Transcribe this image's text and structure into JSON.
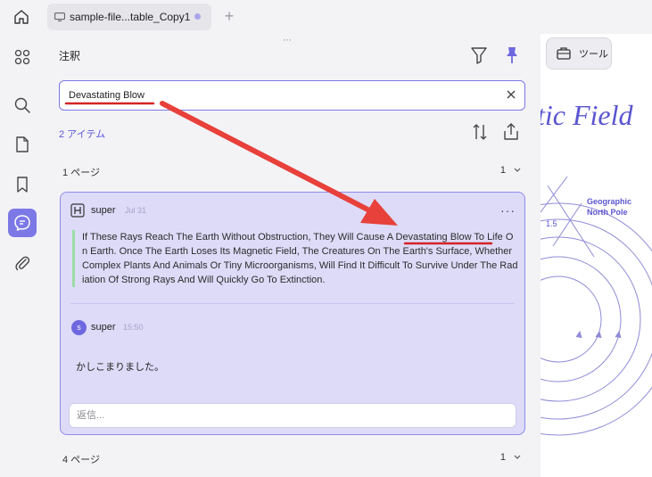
{
  "tabbar": {
    "tab_title": "sample-file...table_Copy1",
    "add_tab": "+"
  },
  "panel": {
    "title": "注釈",
    "drag_handle": "⋯",
    "search": {
      "value": "Devastating Blow"
    },
    "count": "2 アイテム",
    "groups": [
      {
        "label": "1 ページ",
        "count": "1"
      },
      {
        "label": "4 ページ",
        "count": "1"
      }
    ],
    "card": {
      "user": "super",
      "date": "Jul 31",
      "more": "···",
      "quote": "If These Rays Reach The Earth Without Obstruction, They Will Cause A Devastating Blow To Life On Earth. Once The Earth Loses Its Magnetic Field, The Creatures On The Earth's Surface, Whether Complex Plants And Animals Or Tiny Microorganisms, Will Find It Difficult To Survive Under The Radiation Of Strong Rays And Will Quickly Go To Extinction.",
      "reply": {
        "avatar_initial": "s",
        "user": "super",
        "time": "15:50",
        "text": "かしこまりました。",
        "input_placeholder": "返信..."
      }
    }
  },
  "document": {
    "heading_fragment": "tic Field",
    "diagram_label_1": "Geographic",
    "diagram_label_2": "North Pole",
    "diagram_number": "1.5",
    "tool_label": "ツール"
  },
  "colors": {
    "accent": "#7c78e6",
    "card_bg": "#dddbf8",
    "card_border": "#8f8be9",
    "quote_bar": "#9cdca6",
    "arrow": "#e8403a",
    "underline": "#d42424"
  },
  "icons": {
    "home": "home-icon",
    "tab": "monitor-icon",
    "rail": [
      "grid-icon",
      "search-icon",
      "page-icon",
      "bookmark-icon",
      "comment-icon",
      "paperclip-icon"
    ],
    "filter": "filter-icon",
    "pin": "pin-icon",
    "clear": "close-icon",
    "sort": "sort-icon",
    "export": "export-icon",
    "tool": "toolbox-icon"
  }
}
